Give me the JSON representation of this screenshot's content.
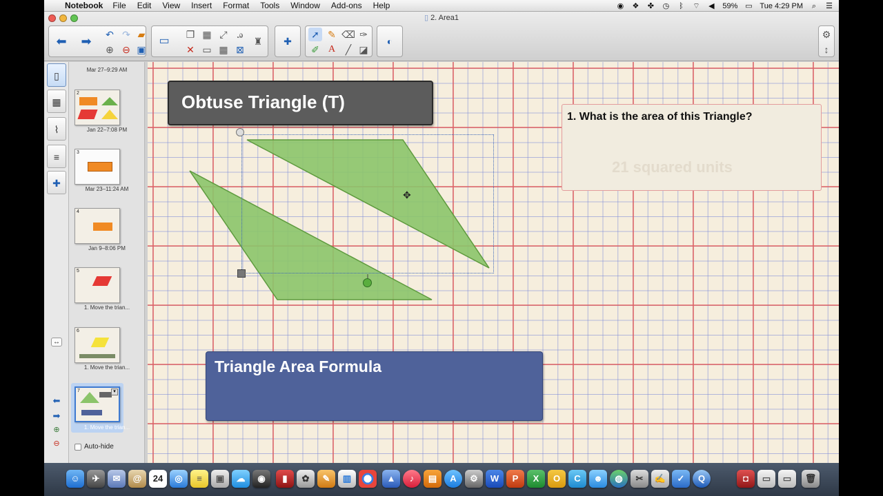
{
  "menubar": {
    "app_name": "Notebook",
    "items": [
      "File",
      "Edit",
      "View",
      "Insert",
      "Format",
      "Tools",
      "Window",
      "Add-ons",
      "Help"
    ],
    "battery": "59%",
    "clock": "Tue 4:29 PM"
  },
  "window": {
    "title": "2. Area1"
  },
  "toolbar": {
    "icons": [
      "back-arrow-icon",
      "forward-arrow-icon",
      "undo-icon",
      "redo-icon",
      "open-folder-icon",
      "new-page-icon",
      "delete-page-icon",
      "save-icon",
      "screen-shade-icon",
      "paste-icon",
      "screen-capture-icon",
      "full-screen-icon",
      "spell-icon",
      "delete-icon",
      "table-icon",
      "properties-icon",
      "addon-icon",
      "select-icon",
      "pens-icon",
      "text-icon",
      "eraser-icon",
      "line-icon",
      "fill-icon",
      "shapes-icon",
      "settings-icon",
      "expand-icon"
    ]
  },
  "side_tabs": [
    "page-sorter-icon",
    "gallery-icon",
    "attachments-icon",
    "properties-icon",
    "addons-icon"
  ],
  "page_sorter": {
    "top_stamp": "Mar 27–9:29 AM",
    "pages": [
      {
        "num": "2",
        "stamp": "Jan 22–7:08 PM"
      },
      {
        "num": "3",
        "stamp": "Mar 23–11:24 AM"
      },
      {
        "num": "4",
        "stamp": "Jan 9–8:06 PM"
      },
      {
        "num": "5",
        "stamp": "1. Move the trian..."
      },
      {
        "num": "6",
        "stamp": "1. Move the trian..."
      },
      {
        "num": "7",
        "stamp": "1. Move the trian..."
      }
    ],
    "auto_hide": "Auto-hide"
  },
  "canvas": {
    "title": "Obtuse Triangle (T)",
    "question": "1. What is the area of this Triangle?",
    "hidden_answer": "21 squared units",
    "formula_title": "Triangle Area Formula"
  },
  "colors": {
    "triangle_fill": "#8cc46a",
    "triangle_stroke": "#5e9a3e",
    "title_box": "#5c5c5c",
    "formula_box": "#4f629a",
    "grid_red": "#e26262",
    "grid_blue": "#7887d7"
  },
  "dock": {
    "calendar_day": "24"
  }
}
